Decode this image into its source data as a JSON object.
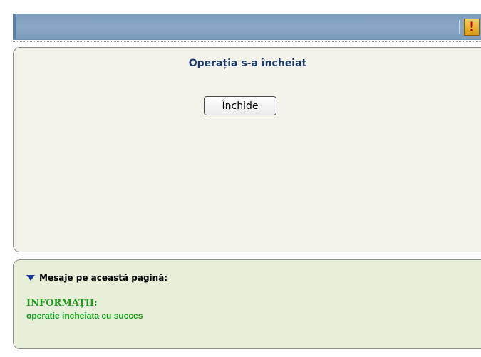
{
  "toolbar": {
    "alert_icon": "exclamation-alert-icon",
    "alert_glyph": "!"
  },
  "main": {
    "title": "Operația s-a încheiat",
    "close_button": {
      "pre": "În",
      "underlined": "c",
      "post": "hide"
    }
  },
  "messages": {
    "header": "Mesaje pe această pagină:",
    "category": "INFORMAŢII:",
    "text": "operatie incheiata cu succes"
  }
}
